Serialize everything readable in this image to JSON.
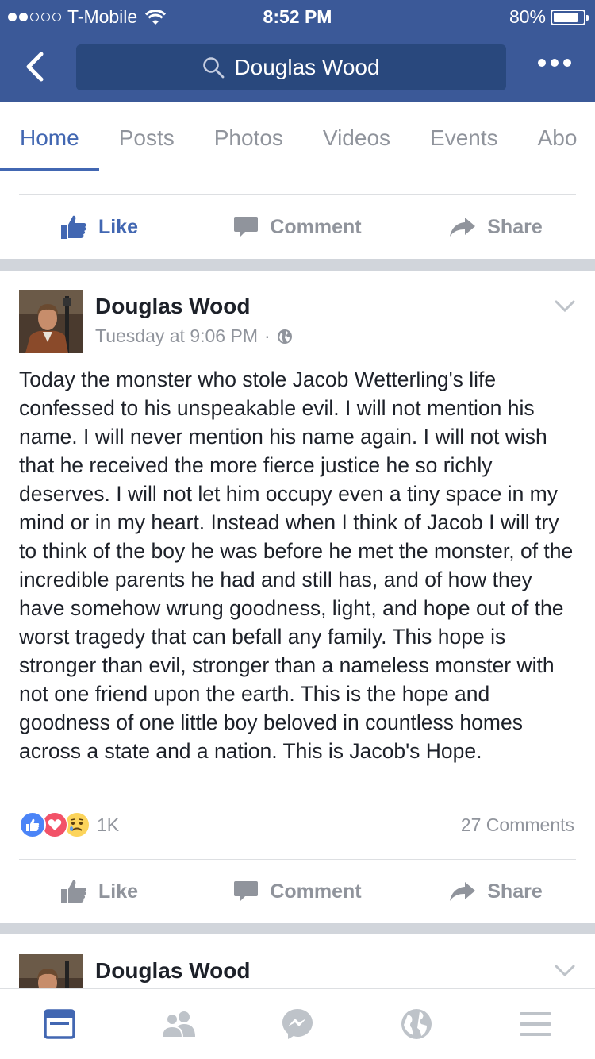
{
  "status": {
    "carrier": "T-Mobile",
    "time": "8:52 PM",
    "battery": "80%",
    "signal_bars_filled": 2,
    "signal_bars_total": 5
  },
  "nav": {
    "search_text": "Douglas Wood"
  },
  "tabs": [
    {
      "label": "Home",
      "active": true
    },
    {
      "label": "Posts"
    },
    {
      "label": "Photos"
    },
    {
      "label": "Videos"
    },
    {
      "label": "Events"
    },
    {
      "label": "Abo"
    }
  ],
  "actions": {
    "like": "Like",
    "comment": "Comment",
    "share": "Share"
  },
  "post": {
    "author": "Douglas Wood",
    "time": "Tuesday at 9:06 PM",
    "separator": "·",
    "text": "Today the monster who stole Jacob Wetterling's life confessed to his unspeakable evil. I will not mention his name. I will never mention his name again. I will not wish that he received the more fierce justice he so richly deserves. I will not let him occupy even a tiny space in my mind or in my heart. Instead when I think of Jacob I will try to think of the boy he was before he met the monster, of the incredible parents he had and still has, and of how they have somehow wrung goodness, light, and hope out of the worst tragedy that can befall any family. This hope is stronger than evil, stronger than a nameless monster with not one friend upon the earth. This is the hope and goodness of one little boy beloved in countless homes across a state and a nation. This is Jacob's Hope.",
    "reaction_count": "1K",
    "comments": "27 Comments"
  },
  "next_post": {
    "author": "Douglas Wood"
  },
  "colors": {
    "brand": "#3b5998",
    "accent": "#4267b2",
    "muted": "#90949c"
  }
}
